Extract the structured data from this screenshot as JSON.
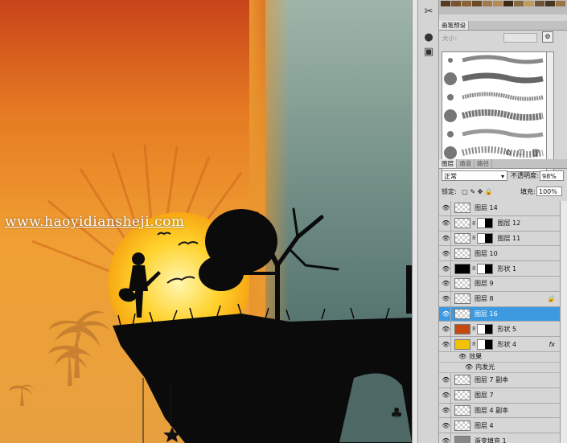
{
  "canvas": {
    "watermark": "www.haoyidiansheji.com"
  },
  "toolstrip": {
    "icons": [
      "scissors-icon",
      "circle-tool-icon",
      "square-tool-icon"
    ]
  },
  "swatches": {
    "colors": [
      "#5a3a1e",
      "#7a5230",
      "#8c6238",
      "#6b4a2a",
      "#a07a48",
      "#b48a52",
      "#3d2a16",
      "#8a6a40",
      "#c29a5e",
      "#6e5434",
      "#4a3620",
      "#9a7444"
    ]
  },
  "brush_presets": {
    "tab_label": "画笔预设",
    "size_label": "大小：",
    "icons": [
      "brush-panel-icon",
      "create-new-icon",
      "delete-icon"
    ]
  },
  "layers_panel": {
    "tabs": [
      "图层",
      "通道",
      "路径"
    ],
    "blend_mode": "正常",
    "opacity_label": "不透明度:",
    "opacity_value": "98%",
    "lock_label": "锁定:",
    "fill_label": "填充:",
    "fill_value": "100%",
    "layers": [
      {
        "name": "图层 14",
        "thumb": "checker",
        "mask": false,
        "selected": false
      },
      {
        "name": "图层 12",
        "thumb": "checker",
        "mask": true,
        "selected": false
      },
      {
        "name": "图层 11",
        "thumb": "checker",
        "mask": true,
        "selected": false
      },
      {
        "name": "图层 10",
        "thumb": "checker",
        "mask": false,
        "selected": false
      },
      {
        "name": "形状 1",
        "thumb": "black",
        "mask": true,
        "selected": false
      },
      {
        "name": "图层 9",
        "thumb": "checker",
        "mask": false,
        "selected": false
      },
      {
        "name": "图层 8",
        "thumb": "checker",
        "mask": false,
        "selected": false,
        "locked": true
      },
      {
        "name": "图层 16",
        "thumb": "checker",
        "mask": false,
        "selected": true
      },
      {
        "name": "形状 5",
        "thumb": "orange",
        "mask": true,
        "selected": false
      },
      {
        "name": "形状 4",
        "thumb": "yellow",
        "mask": true,
        "selected": false,
        "fx": "fx"
      }
    ],
    "effects_label": "效果",
    "inner_glow_label": "内发光",
    "layers_after": [
      {
        "name": "图层 7 副本",
        "thumb": "checker"
      },
      {
        "name": "图层 7",
        "thumb": "checker"
      },
      {
        "name": "图层 4 副本",
        "thumb": "checker"
      },
      {
        "name": "图层 4",
        "thumb": "checker"
      },
      {
        "name": "渐变填充 1",
        "thumb": "grey"
      }
    ]
  },
  "colors": {
    "selection": "#3d9ae0",
    "panel_bg": "#d6d6d6"
  }
}
